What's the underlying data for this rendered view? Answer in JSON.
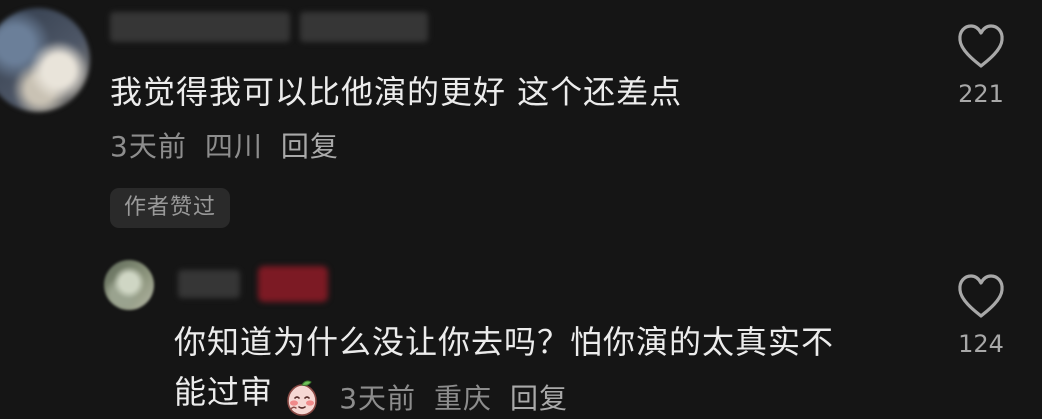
{
  "comments": [
    {
      "text": "我觉得我可以比他演的更好 这个还差点",
      "time": "3天前",
      "location": "四川",
      "reply_label": "回复",
      "badge": "作者赞过",
      "likes": "221"
    },
    {
      "text_line1": "你知道为什么没让你去吗？怕你演的太真实不",
      "text_line2": "能过审",
      "emoji_icon": "shy-peach-emoji",
      "time": "3天前",
      "location": "重庆",
      "reply_label": "回复",
      "likes": "124"
    }
  ],
  "colors": {
    "background": "#151515",
    "text": "#ececec",
    "meta": "#8d8d8d"
  }
}
